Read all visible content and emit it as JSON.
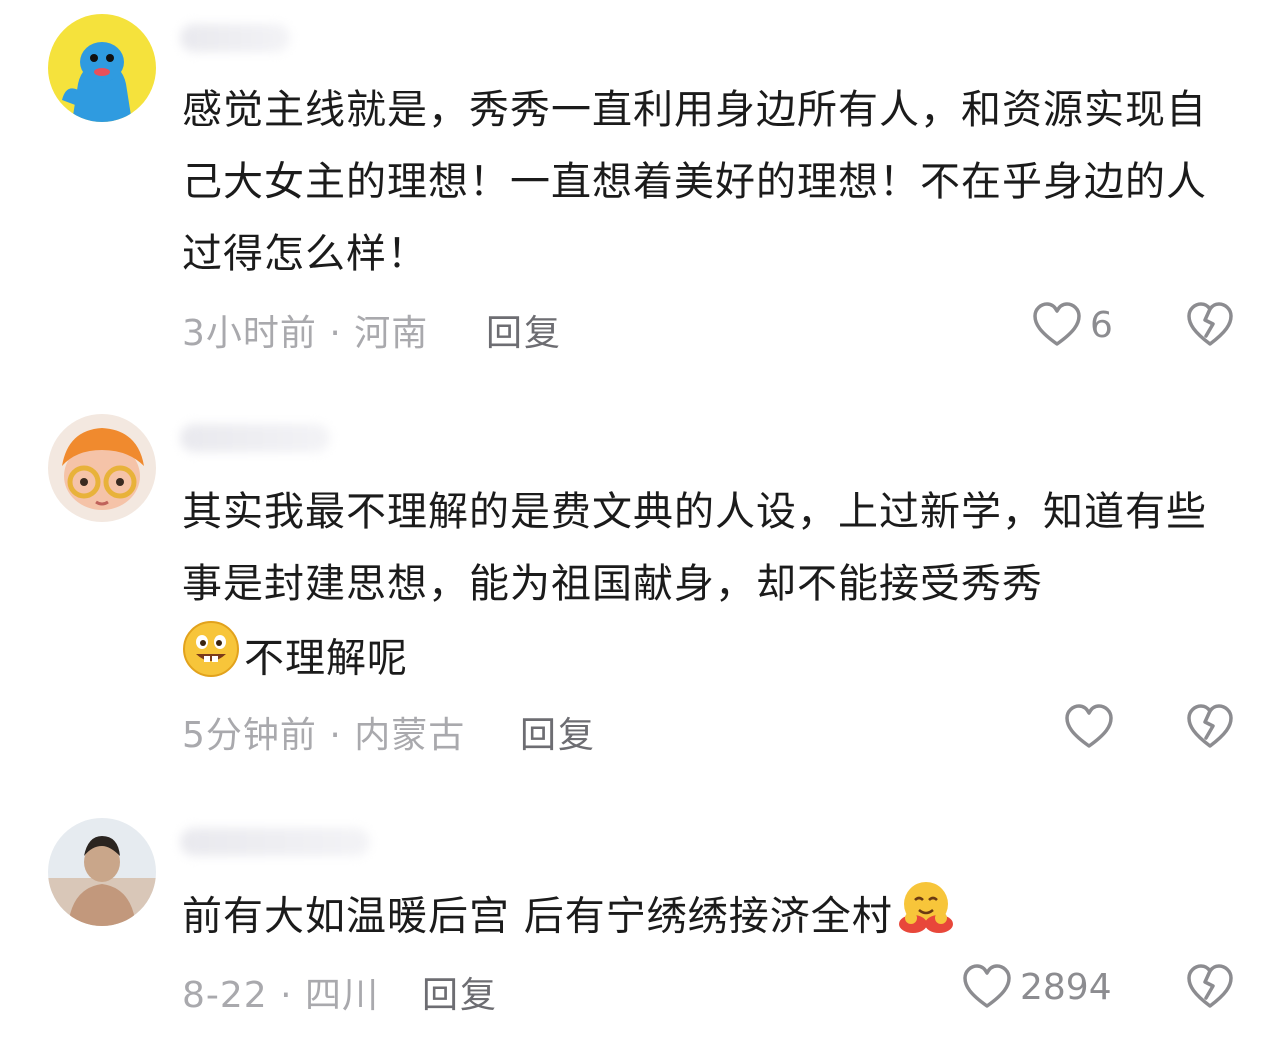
{
  "comments": [
    {
      "text": "感觉主线就是，秀秀一直利用身边所有人，和资源实现自己大女主的理想！一直想着美好的理想！不在乎身边的人过得怎么样！",
      "time_location": "3小时前 · 河南",
      "reply_label": "回复",
      "like_count": "6"
    },
    {
      "text": "其实我最不理解的是费文典的人设，上过新学，知道有些事是封建思想，能为祖国献身，却不能接受秀秀",
      "text_tail": "不理解呢",
      "tail_emoji": "grinning-face-emoji",
      "time_location": "5分钟前 · 内蒙古",
      "reply_label": "回复",
      "like_count": ""
    },
    {
      "text": "前有大如温暖后宫 后有宁绣绣接济全村",
      "trailing_emoji": "hugging-face-emoji",
      "time_location": "8-22 · 四川",
      "reply_label": "回复",
      "like_count": "2894"
    }
  ],
  "icons": {
    "like": "heart-outline-icon",
    "dislike": "broken-heart-icon"
  },
  "colors": {
    "text": "#1b1b1b",
    "meta": "#a9a9ad",
    "reply": "#6d6d72",
    "icon": "#8c8c90"
  }
}
